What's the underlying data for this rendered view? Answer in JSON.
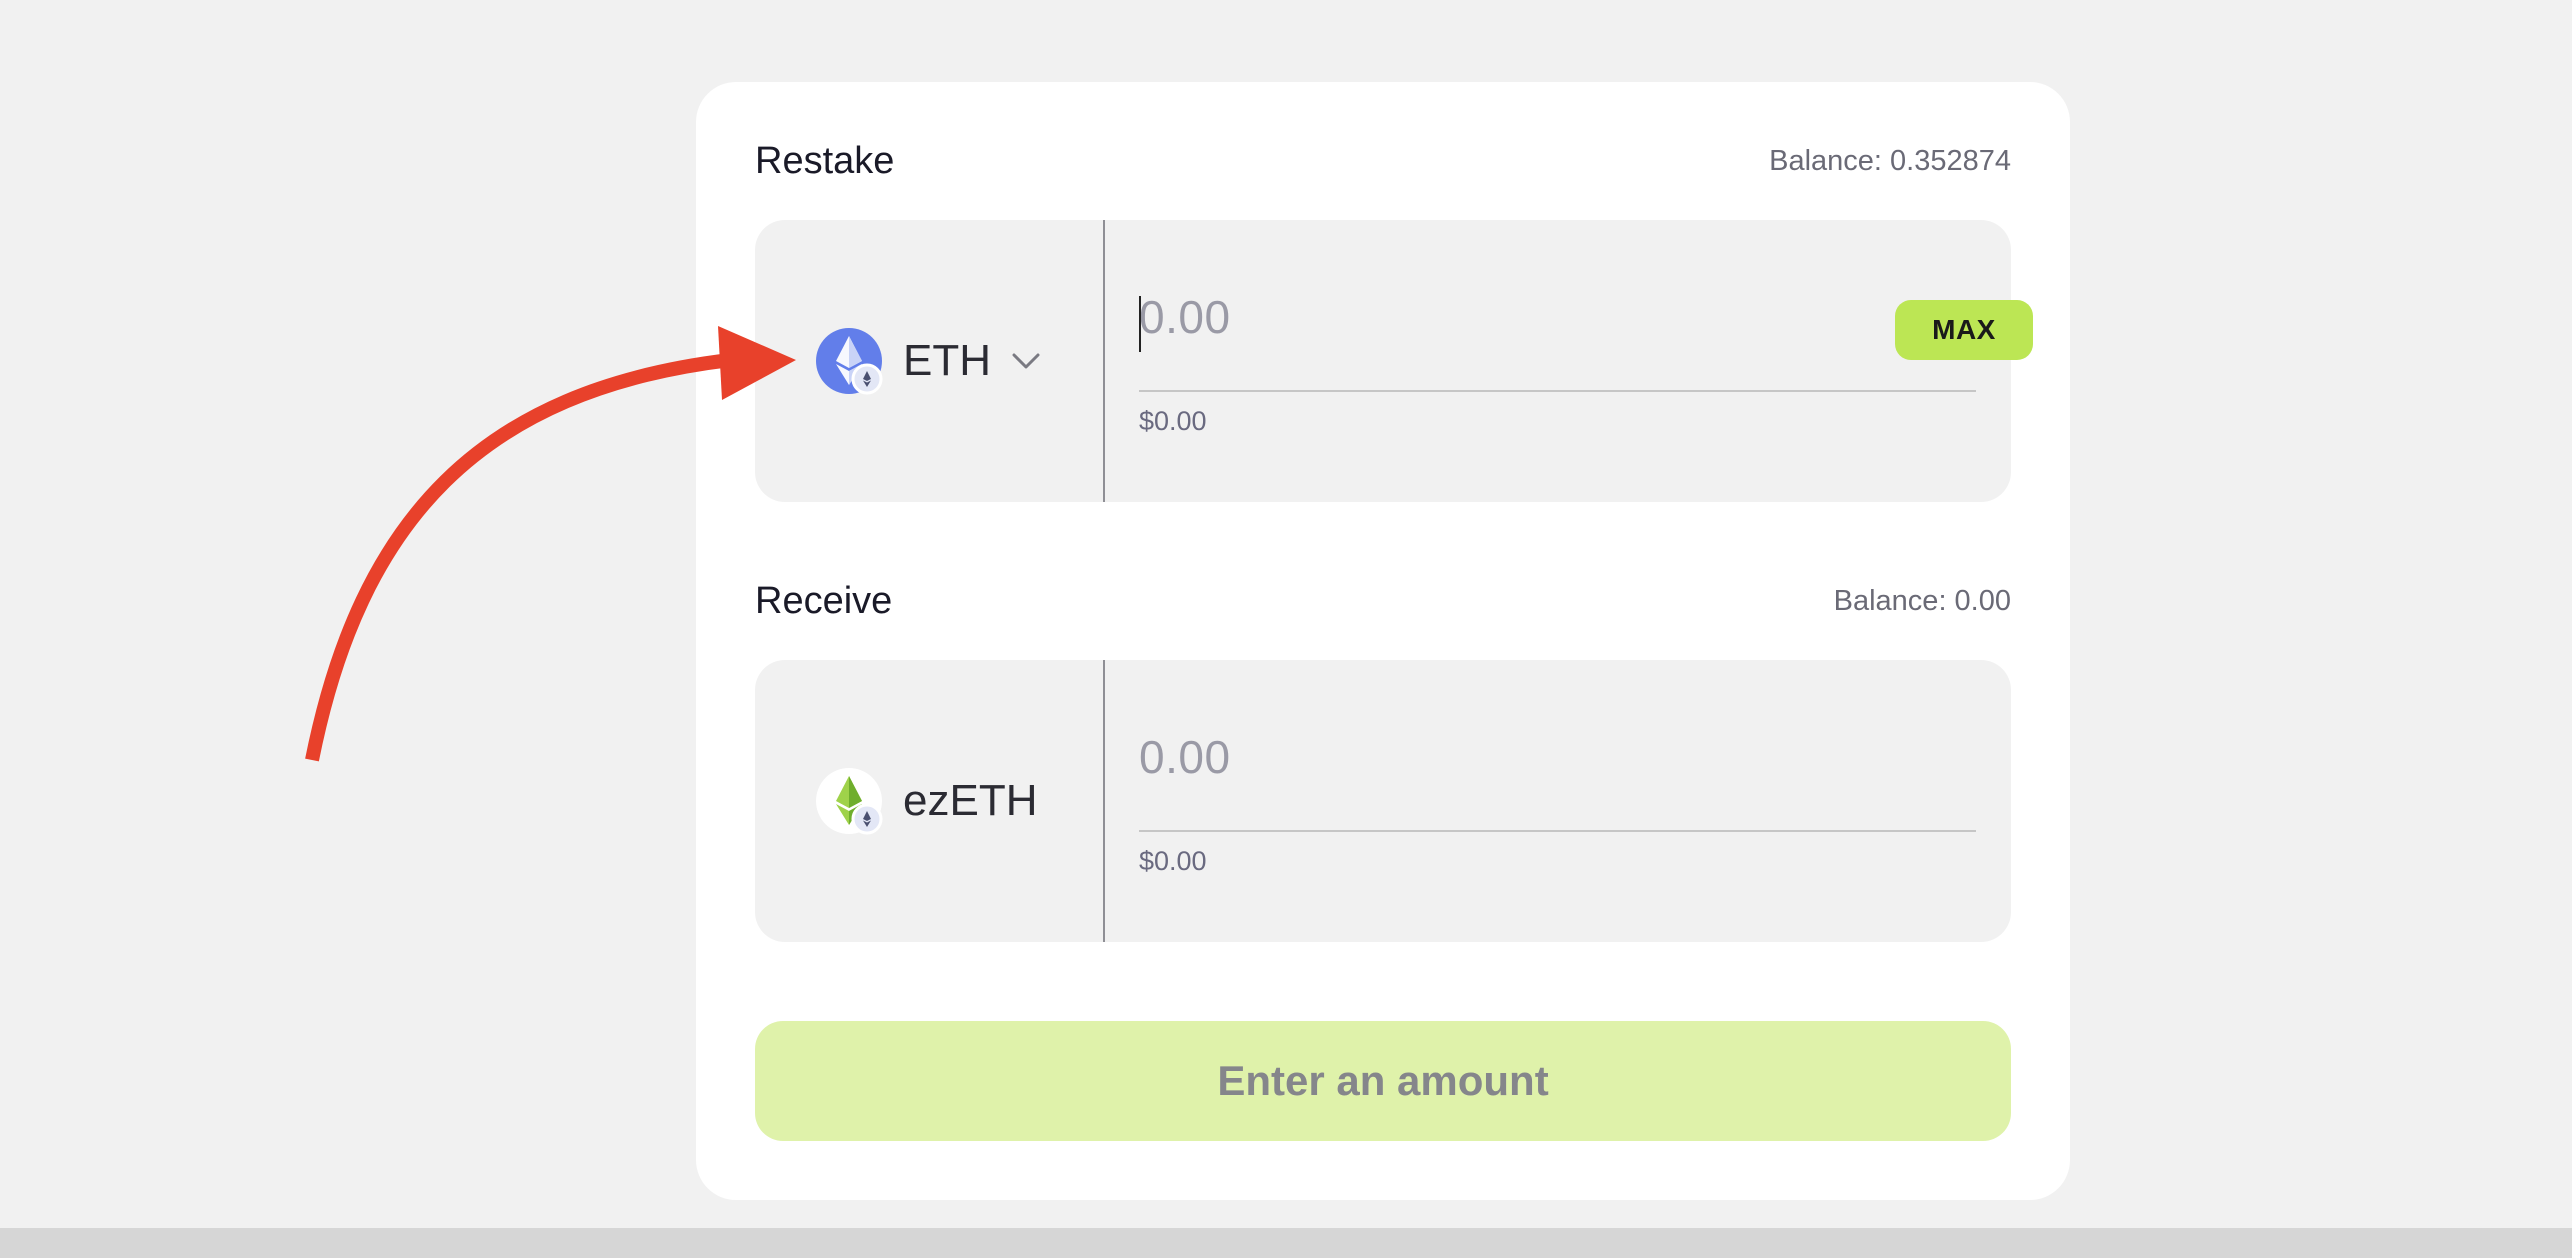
{
  "restake": {
    "title": "Restake",
    "balance": "Balance: 0.352874",
    "token": {
      "symbol": "ETH",
      "icon": "eth-icon",
      "has_dropdown": true
    },
    "amount_placeholder": "0.00",
    "usd_value": "$0.00",
    "max_label": "MAX"
  },
  "receive": {
    "title": "Receive",
    "balance": "Balance: 0.00",
    "token": {
      "symbol": "ezETH",
      "icon": "ezeth-icon"
    },
    "amount_placeholder": "0.00",
    "usd_value": "$0.00"
  },
  "action": {
    "label": "Enter an amount"
  },
  "colors": {
    "accent": "#bce654",
    "accent_disabled": "#dff2aa",
    "annotation_arrow": "#e8412b",
    "eth_blue": "#627eea"
  }
}
